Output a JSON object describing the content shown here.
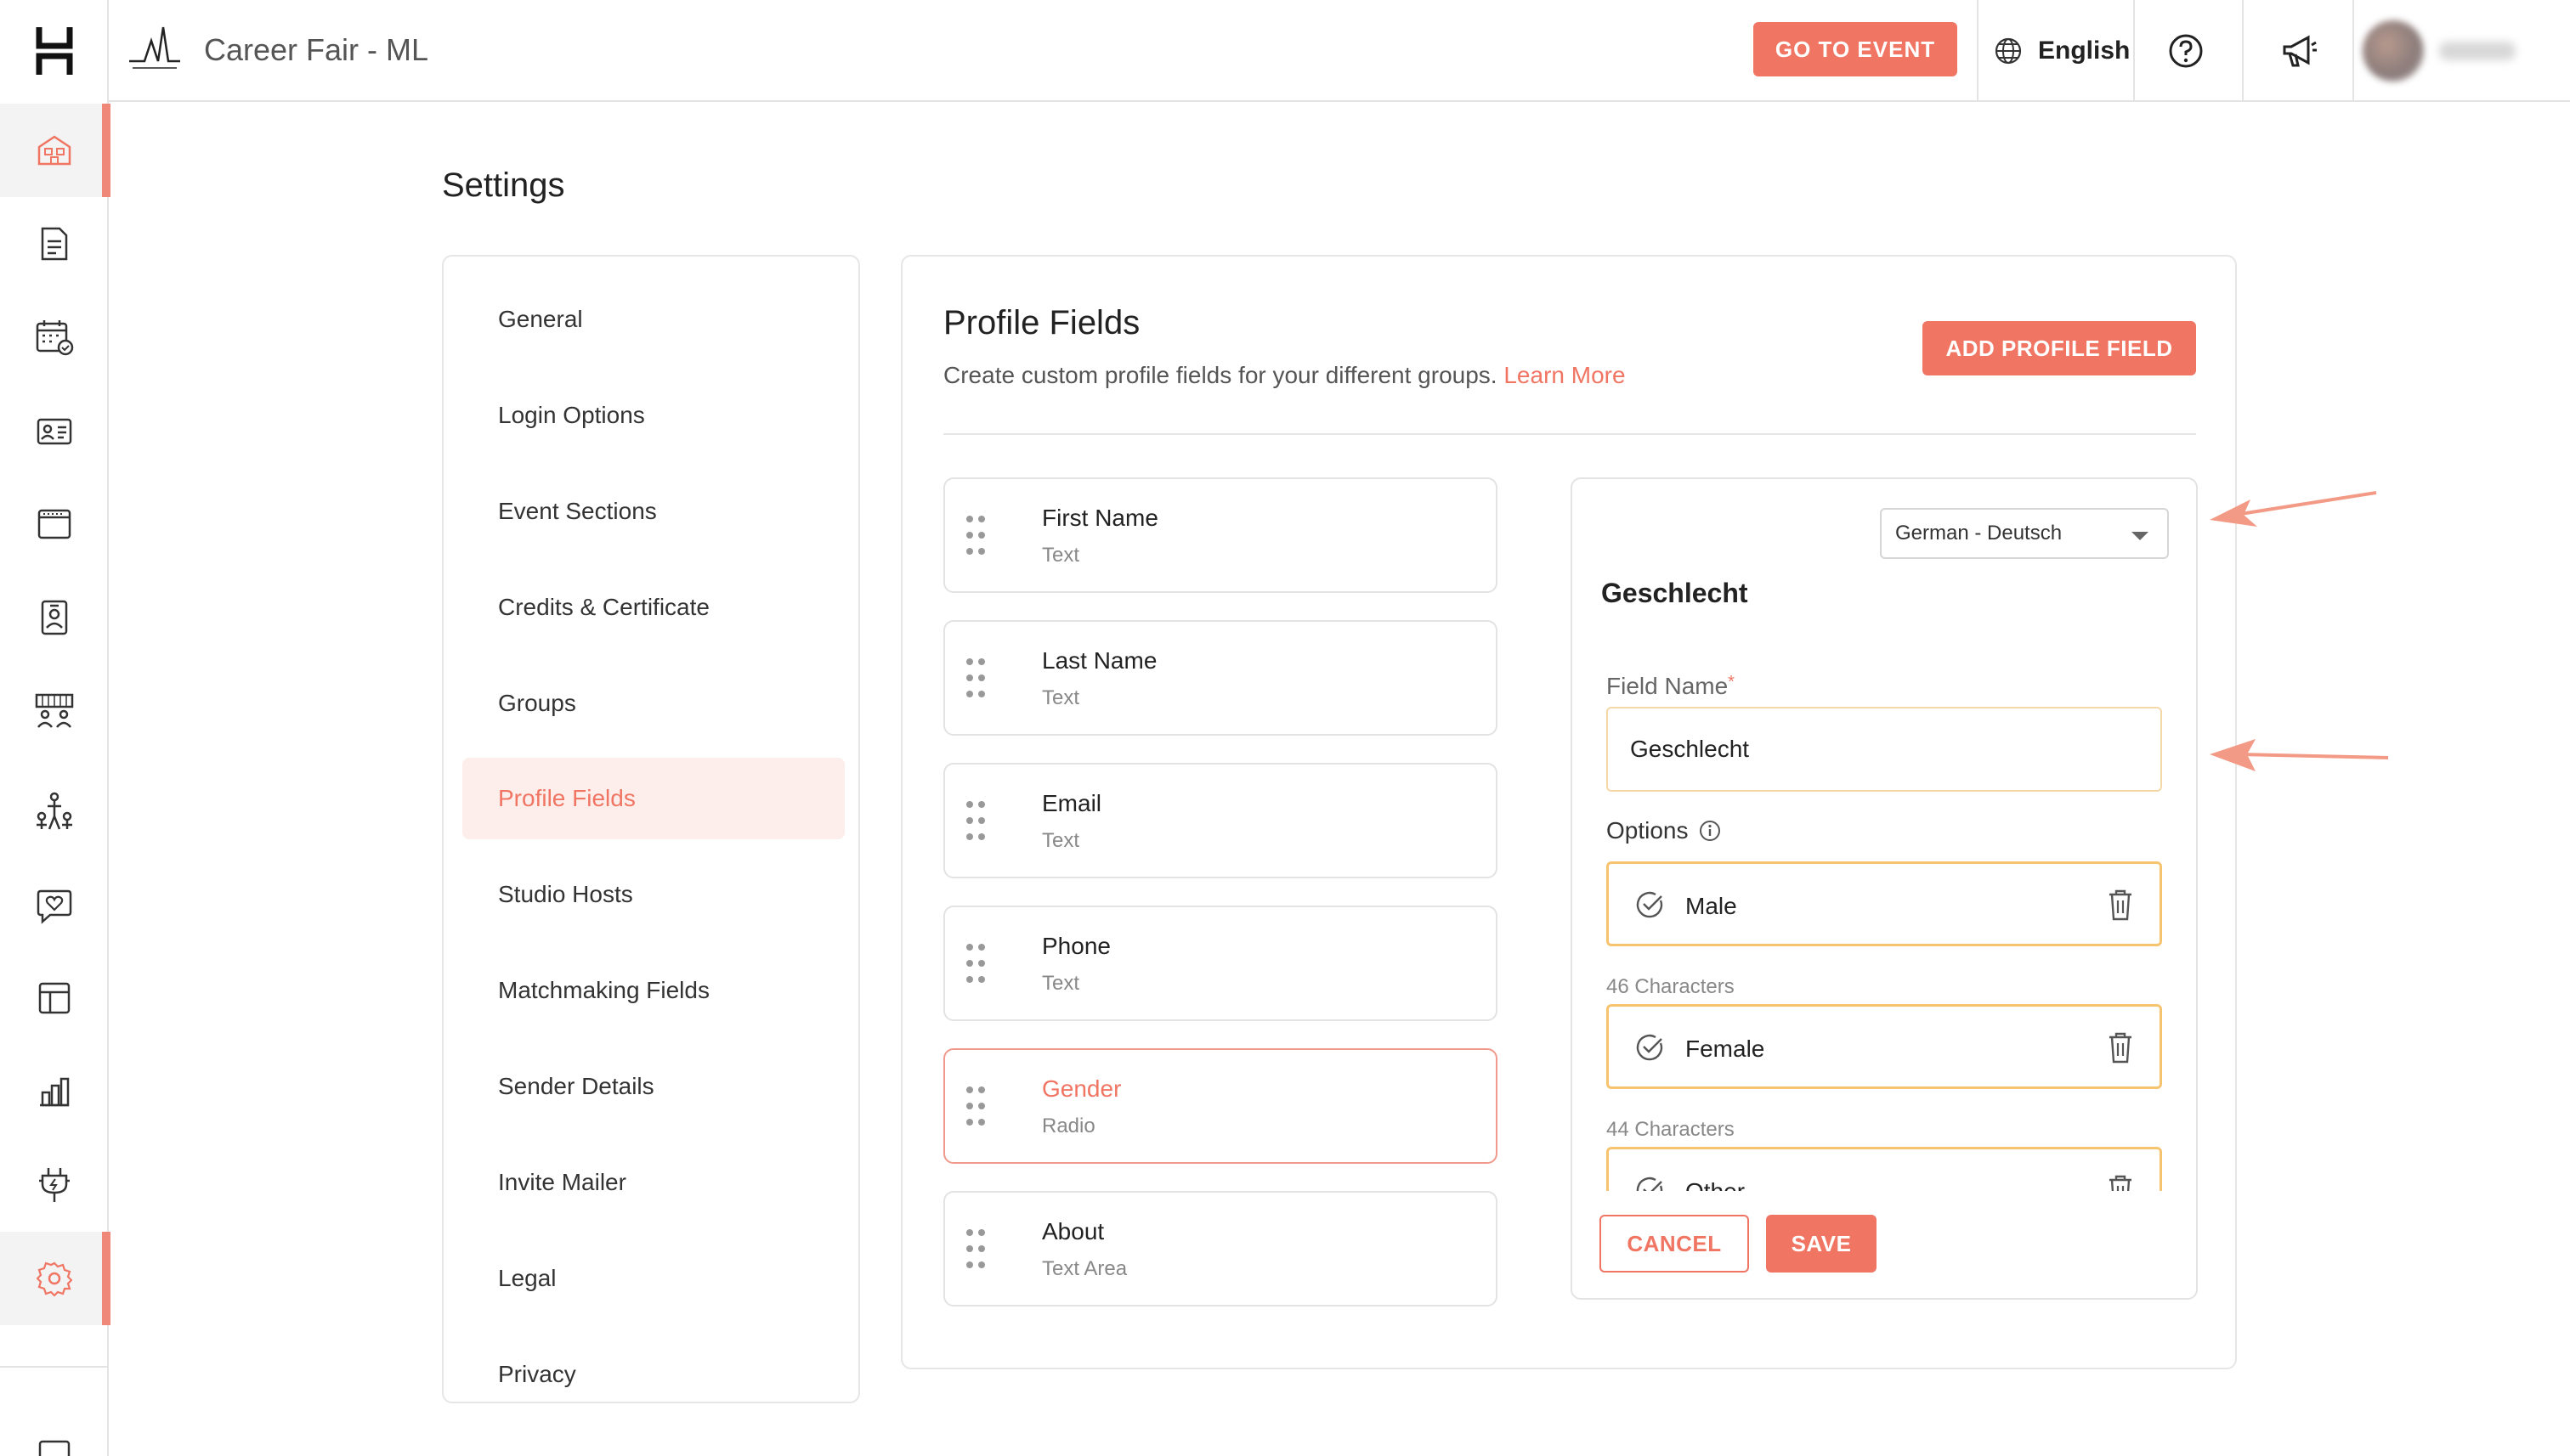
{
  "app": {
    "event_title": "Career Fair - ML"
  },
  "topbar": {
    "go_to_event": "GO TO EVENT",
    "language": "English"
  },
  "page": {
    "title": "Settings"
  },
  "settings_nav": {
    "items": [
      {
        "label": "General",
        "active": false
      },
      {
        "label": "Login Options",
        "active": false
      },
      {
        "label": "Event Sections",
        "active": false
      },
      {
        "label": "Credits & Certificate",
        "active": false
      },
      {
        "label": "Groups",
        "active": false
      },
      {
        "label": "Profile Fields",
        "active": true
      },
      {
        "label": "Studio Hosts",
        "active": false
      },
      {
        "label": "Matchmaking Fields",
        "active": false
      },
      {
        "label": "Sender Details",
        "active": false
      },
      {
        "label": "Invite Mailer",
        "active": false
      },
      {
        "label": "Legal",
        "active": false
      },
      {
        "label": "Privacy",
        "active": false
      }
    ]
  },
  "profile_fields": {
    "title": "Profile Fields",
    "subtitle": "Create custom profile fields for your different groups.",
    "learn_more": "Learn More",
    "add_button": "ADD PROFILE FIELD",
    "fields": [
      {
        "name": "First Name",
        "type": "Text"
      },
      {
        "name": "Last Name",
        "type": "Text"
      },
      {
        "name": "Email",
        "type": "Text"
      },
      {
        "name": "Phone",
        "type": "Text"
      },
      {
        "name": "Gender",
        "type": "Radio",
        "selected": true
      },
      {
        "name": "About",
        "type": "Text Area"
      }
    ]
  },
  "editor": {
    "language_select": "German - Deutsch",
    "title": "Geschlecht",
    "field_name_label": "Field Name",
    "required_mark": "*",
    "field_name_value": "Geschlecht",
    "options_label": "Options",
    "options": [
      {
        "value": "Male",
        "count": "46 Characters"
      },
      {
        "value": "Female",
        "count": "44 Characters"
      },
      {
        "value": "Other",
        "count": ""
      }
    ],
    "cancel": "CANCEL",
    "save": "SAVE"
  },
  "colors": {
    "accent": "#f07563",
    "accent_light": "#fdeeeb",
    "option_border": "#f6c46f",
    "arrow": "#f39a86"
  },
  "icons": {
    "rail": [
      "home-icon",
      "document-icon",
      "calendar-icon",
      "id-card-icon",
      "window-icon",
      "badge-icon",
      "booths-icon",
      "networking-icon",
      "chat-heart-icon",
      "layout-icon",
      "analytics-icon",
      "plugin-icon",
      "settings-icon",
      "bottom-icon"
    ],
    "topbar": [
      "globe-icon",
      "help-icon",
      "megaphone-icon"
    ]
  }
}
